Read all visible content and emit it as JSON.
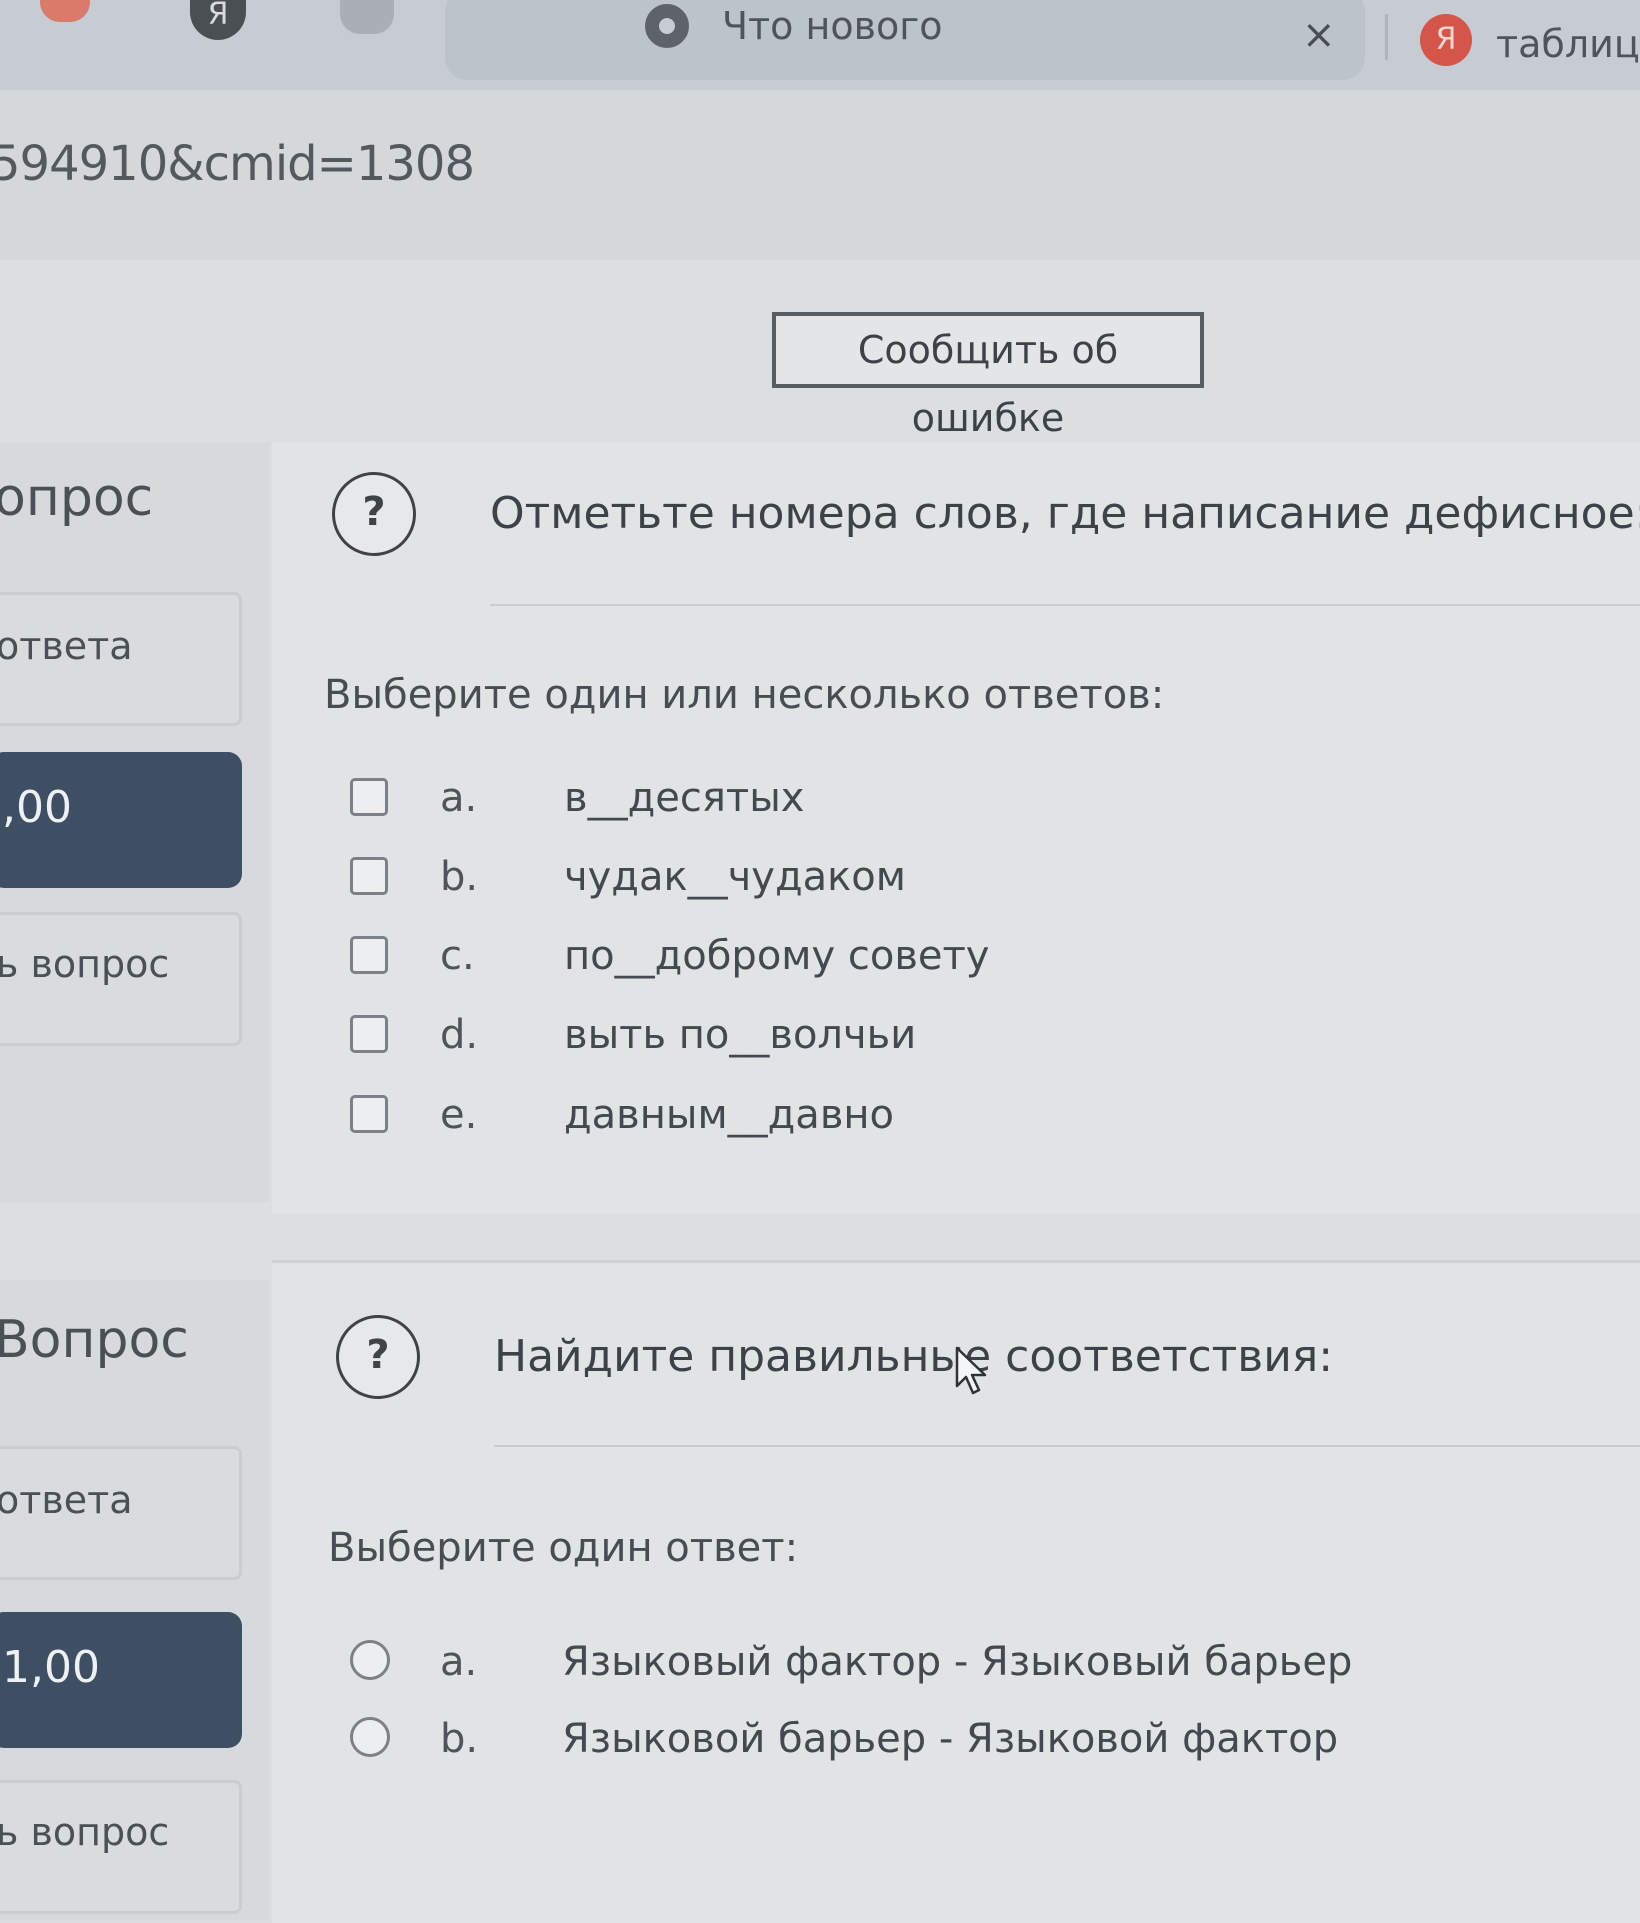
{
  "browser": {
    "tabs": [
      {
        "title": "Что нового",
        "close_glyph": "×"
      },
      {
        "title": "таблицу"
      }
    ],
    "yandex_letter": "Я",
    "url": "594910&cmid=1308"
  },
  "page": {
    "report_button": "Сообщить об ошибке",
    "questions": [
      {
        "nav": {
          "label": "опрос",
          "status": "ответа",
          "grade": ",00",
          "flag": "ь вопрос"
        },
        "help_glyph": "?",
        "text": "Отметьте номера слов, где написание дефисное:",
        "prompt": "Выберите один или несколько ответов:",
        "input_type": "checkbox",
        "options": [
          {
            "letter": "a.",
            "text": "в__десятых"
          },
          {
            "letter": "b.",
            "text": "чудак__чудаком"
          },
          {
            "letter": "c.",
            "text": "по__доброму совету"
          },
          {
            "letter": "d.",
            "text": "выть по__волчьи"
          },
          {
            "letter": "e.",
            "text": "давным__давно"
          }
        ]
      },
      {
        "nav": {
          "label": "Вопрос",
          "status": "ответа",
          "grade": "1,00",
          "flag": "ь вопрос"
        },
        "help_glyph": "?",
        "text": "Найдите правильные соответствия:",
        "prompt": "Выберите один ответ:",
        "input_type": "radio",
        "options": [
          {
            "letter": "a.",
            "text": "Языковый фактор - Языковый барьер"
          },
          {
            "letter": "b.",
            "text": "Языковой барьер - Языковой фактор"
          }
        ]
      }
    ]
  },
  "icons": {
    "tab_icon": "chrome-icon",
    "tab2_icon": "yandex-icon",
    "help": "question-circle-icon",
    "pointer": "mouse-cursor-icon"
  }
}
